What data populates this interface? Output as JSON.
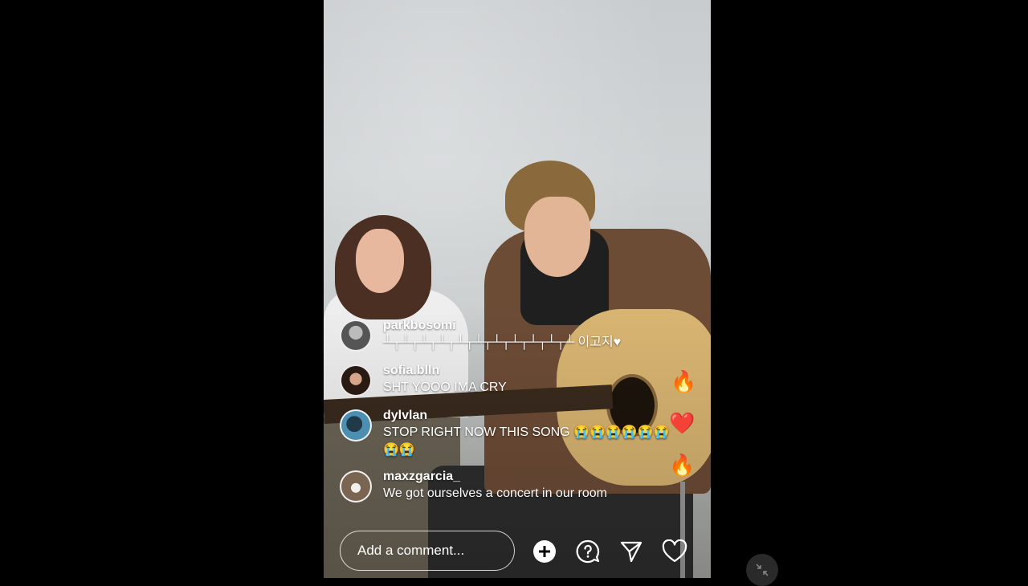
{
  "comments": [
    {
      "username": "parkbosomi",
      "text": "┴┬┴┬┴┬┴┬┴┬┴┬┴┬┴┬┴┬┴┬┴ 이고지♥",
      "avatar": "avatar-parkbosomi"
    },
    {
      "username": "sofia.blln",
      "text": "SHT YOOO IMA CRY",
      "avatar": "avatar-sofia"
    },
    {
      "username": "dylvlan",
      "text": "STOP RIGHT NOW THIS SONG 😭😭😭😭😭😭😭😭",
      "avatar": "avatar-dylvlan"
    },
    {
      "username": "maxzgarcia_",
      "text": "We got ourselves a concert in our room",
      "avatar": "avatar-maxz"
    }
  ],
  "composer": {
    "placeholder": "Add a comment..."
  },
  "actions": {
    "add": "plus-circle-icon",
    "question": "question-bubble-icon",
    "share": "paper-plane-icon",
    "like": "heart-icon"
  },
  "colors": {
    "background": "#000000",
    "text": "#ffffff"
  }
}
